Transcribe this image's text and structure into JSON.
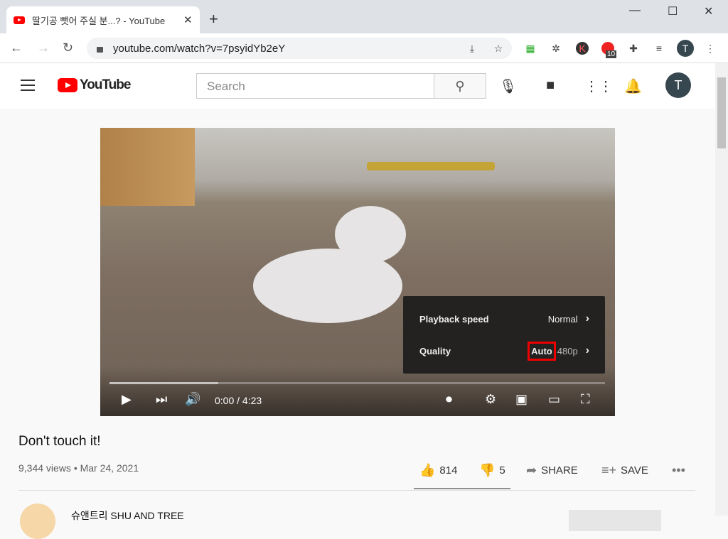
{
  "browser": {
    "tab_title": "딸기공 뺏어 주실 분...? - YouTube",
    "url": "youtube.com/watch?v=7psyidYb2eY",
    "extension_badge": "10",
    "profile_initial": "T"
  },
  "header": {
    "search_placeholder": "Search",
    "avatar_initial": "T"
  },
  "player": {
    "time": "0:00 / 4:23",
    "progress_fraction": 0.22,
    "settings_menu": [
      {
        "label": "Playback speed",
        "value": "Normal"
      },
      {
        "label": "Quality",
        "value": "Auto",
        "detail": "480p"
      }
    ]
  },
  "video": {
    "title": "Don't touch it!",
    "meta": "9,344 views • Mar 24, 2021",
    "likes": "814",
    "dislikes": "5",
    "share": "SHARE",
    "save": "SAVE"
  },
  "channel": {
    "name": "슈앤트리 SHU AND TREE"
  },
  "colors": {
    "accent": "#ff0000",
    "highlight": "#e00000"
  }
}
